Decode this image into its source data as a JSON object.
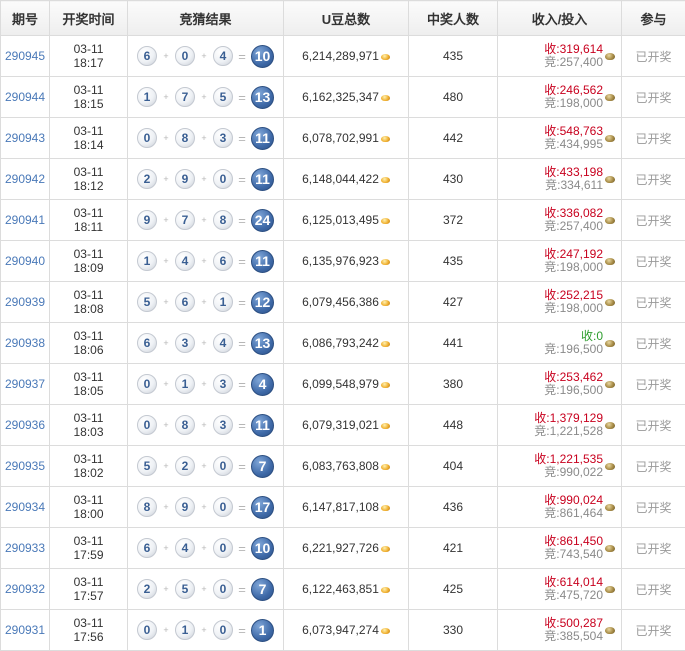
{
  "headers": {
    "issue": "期号",
    "time": "开奖时间",
    "result": "竞猜结果",
    "pool": "U豆总数",
    "winners": "中奖人数",
    "income": "收入/投入",
    "join": "参与"
  },
  "labels": {
    "income_prefix": "收:",
    "bet_prefix": "竞:"
  },
  "rows": [
    {
      "id": "290945",
      "date": "03-11",
      "time": "18:17",
      "n": [
        "6",
        "0",
        "4"
      ],
      "sum": "10",
      "pool": "6,214,289,971",
      "winners": "435",
      "income": "319,614",
      "bet": "257,400",
      "status": "已开奖"
    },
    {
      "id": "290944",
      "date": "03-11",
      "time": "18:15",
      "n": [
        "1",
        "7",
        "5"
      ],
      "sum": "13",
      "pool": "6,162,325,347",
      "winners": "480",
      "income": "246,562",
      "bet": "198,000",
      "status": "已开奖"
    },
    {
      "id": "290943",
      "date": "03-11",
      "time": "18:14",
      "n": [
        "0",
        "8",
        "3"
      ],
      "sum": "11",
      "pool": "6,078,702,991",
      "winners": "442",
      "income": "548,763",
      "bet": "434,995",
      "status": "已开奖"
    },
    {
      "id": "290942",
      "date": "03-11",
      "time": "18:12",
      "n": [
        "2",
        "9",
        "0"
      ],
      "sum": "11",
      "pool": "6,148,044,422",
      "winners": "430",
      "income": "433,198",
      "bet": "334,611",
      "status": "已开奖"
    },
    {
      "id": "290941",
      "date": "03-11",
      "time": "18:11",
      "n": [
        "9",
        "7",
        "8"
      ],
      "sum": "24",
      "pool": "6,125,013,495",
      "winners": "372",
      "income": "336,082",
      "bet": "257,400",
      "status": "已开奖"
    },
    {
      "id": "290940",
      "date": "03-11",
      "time": "18:09",
      "n": [
        "1",
        "4",
        "6"
      ],
      "sum": "11",
      "pool": "6,135,976,923",
      "winners": "435",
      "income": "247,192",
      "bet": "198,000",
      "status": "已开奖"
    },
    {
      "id": "290939",
      "date": "03-11",
      "time": "18:08",
      "n": [
        "5",
        "6",
        "1"
      ],
      "sum": "12",
      "pool": "6,079,456,386",
      "winners": "427",
      "income": "252,215",
      "bet": "198,000",
      "status": "已开奖"
    },
    {
      "id": "290938",
      "date": "03-11",
      "time": "18:06",
      "n": [
        "6",
        "3",
        "4"
      ],
      "sum": "13",
      "pool": "6,086,793,242",
      "winners": "441",
      "income": "0",
      "bet": "196,500",
      "status": "已开奖"
    },
    {
      "id": "290937",
      "date": "03-11",
      "time": "18:05",
      "n": [
        "0",
        "1",
        "3"
      ],
      "sum": "4",
      "pool": "6,099,548,979",
      "winners": "380",
      "income": "253,462",
      "bet": "196,500",
      "status": "已开奖"
    },
    {
      "id": "290936",
      "date": "03-11",
      "time": "18:03",
      "n": [
        "0",
        "8",
        "3"
      ],
      "sum": "11",
      "pool": "6,079,319,021",
      "winners": "448",
      "income": "1,379,129",
      "bet": "1,221,528",
      "status": "已开奖"
    },
    {
      "id": "290935",
      "date": "03-11",
      "time": "18:02",
      "n": [
        "5",
        "2",
        "0"
      ],
      "sum": "7",
      "pool": "6,083,763,808",
      "winners": "404",
      "income": "1,221,535",
      "bet": "990,022",
      "status": "已开奖"
    },
    {
      "id": "290934",
      "date": "03-11",
      "time": "18:00",
      "n": [
        "8",
        "9",
        "0"
      ],
      "sum": "17",
      "pool": "6,147,817,108",
      "winners": "436",
      "income": "990,024",
      "bet": "861,464",
      "status": "已开奖"
    },
    {
      "id": "290933",
      "date": "03-11",
      "time": "17:59",
      "n": [
        "6",
        "4",
        "0"
      ],
      "sum": "10",
      "pool": "6,221,927,726",
      "winners": "421",
      "income": "861,450",
      "bet": "743,540",
      "status": "已开奖"
    },
    {
      "id": "290932",
      "date": "03-11",
      "time": "17:57",
      "n": [
        "2",
        "5",
        "0"
      ],
      "sum": "7",
      "pool": "6,122,463,851",
      "winners": "425",
      "income": "614,014",
      "bet": "475,720",
      "status": "已开奖"
    },
    {
      "id": "290931",
      "date": "03-11",
      "time": "17:56",
      "n": [
        "0",
        "1",
        "0"
      ],
      "sum": "1",
      "pool": "6,073,947,274",
      "winners": "330",
      "income": "500,287",
      "bet": "385,504",
      "status": "已开奖"
    }
  ]
}
